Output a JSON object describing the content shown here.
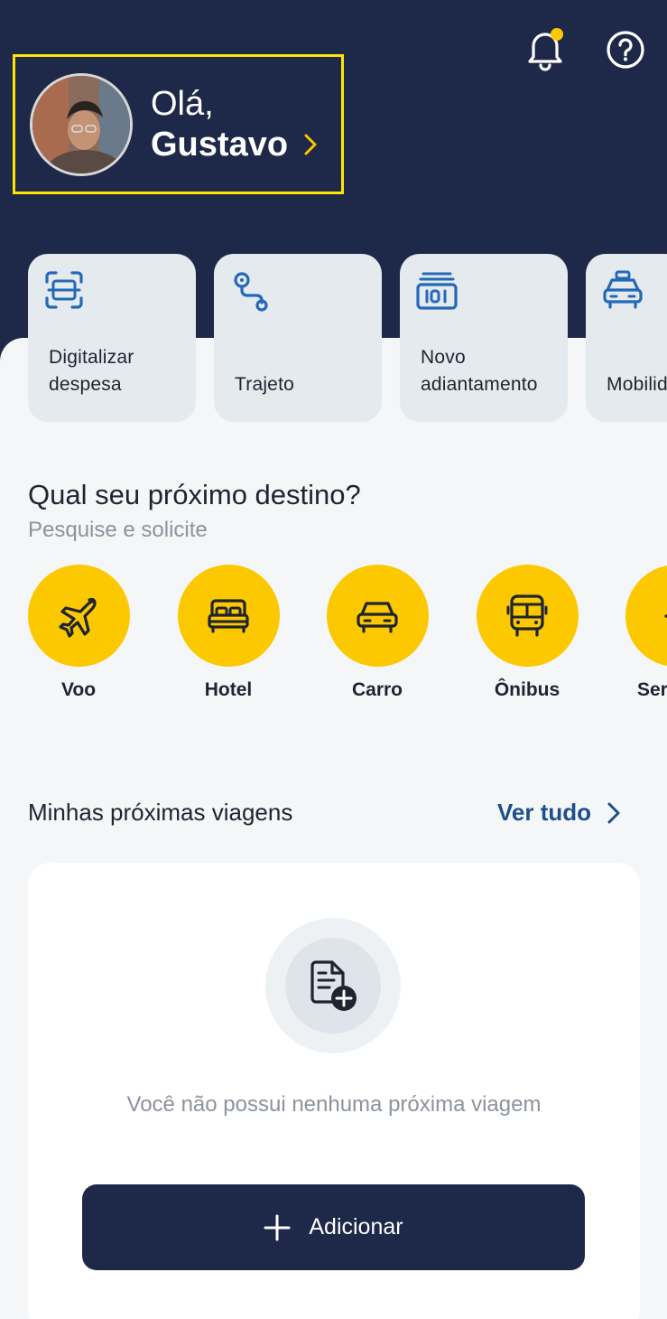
{
  "header": {
    "greeting": "Olá,",
    "user_name": "Gustavo",
    "icons": [
      "bell-icon",
      "help-icon"
    ]
  },
  "quick_actions": [
    {
      "label": "Digitalizar\ndespesa",
      "icon": "scan-receipt-icon"
    },
    {
      "label": "Trajeto",
      "icon": "route-icon"
    },
    {
      "label": "Novo\nadiantamento",
      "icon": "cash-advance-icon"
    },
    {
      "label": "Mobilid",
      "icon": "taxi-icon"
    }
  ],
  "destination": {
    "title": "Qual seu próximo destino?",
    "subtitle": "Pesquise e solicite",
    "categories": [
      {
        "label": "Voo",
        "icon": "plane-icon"
      },
      {
        "label": "Hotel",
        "icon": "bed-icon"
      },
      {
        "label": "Carro",
        "icon": "car-icon"
      },
      {
        "label": "Ônibus",
        "icon": "bus-icon"
      },
      {
        "label": "Ser",
        "icon": "plus-icon"
      }
    ]
  },
  "trips": {
    "title": "Minhas próximas viagens",
    "see_all": "Ver tudo",
    "empty_text": "Você não possui nenhuma próxima viagem",
    "add_label": "Adicionar"
  },
  "colors": {
    "navy": "#1e2848",
    "accent_yellow": "#fcc800",
    "link_blue": "#1d4f8a",
    "icon_blue": "#2369b8"
  }
}
